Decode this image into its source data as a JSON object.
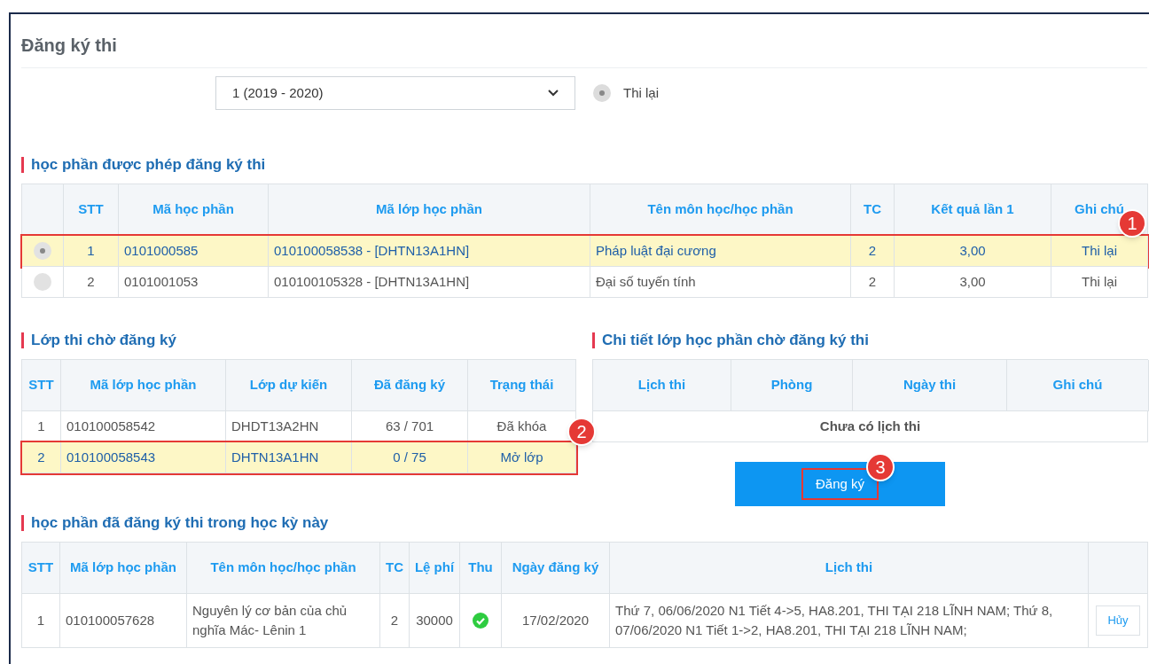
{
  "page_title": "Đăng ký thi",
  "term_select": {
    "value": "1 (2019 - 2020)"
  },
  "exam_types": [
    {
      "label": "Thi lại",
      "selected": true
    }
  ],
  "eligible_courses": {
    "title": "học phần được phép đăng ký thi",
    "columns": [
      "STT",
      "Mã học phần",
      "Mã lớp học phần",
      "Tên môn học/học phần",
      "TC",
      "Kết quả lần 1",
      "Ghi chú"
    ],
    "rows": [
      {
        "selected": true,
        "highlighted": true,
        "badge": "1",
        "cells": [
          "1",
          "0101000585",
          "010100058538 - [DHTN13A1HN]",
          "Pháp luật đại cương",
          "2",
          "3,00",
          "Thi lại"
        ]
      },
      {
        "selected": false,
        "highlighted": false,
        "cells": [
          "2",
          "0101001053",
          "010100105328 - [DHTN13A1HN]",
          "Đại số tuyến tính",
          "2",
          "3,00",
          "Thi lại"
        ]
      }
    ]
  },
  "pending_classes": {
    "title": "Lớp thi chờ đăng ký",
    "columns": [
      "STT",
      "Mã lớp học phần",
      "Lớp dự kiến",
      "Đã đăng ký",
      "Trạng thái"
    ],
    "rows": [
      {
        "highlighted": false,
        "cells": [
          "1",
          "010100058542",
          "DHDT13A2HN",
          "63 / 701",
          "Đã khóa"
        ]
      },
      {
        "highlighted": true,
        "badge": "2",
        "cells": [
          "2",
          "010100058543",
          "DHTN13A1HN",
          "0 / 75",
          "Mở lớp"
        ]
      }
    ]
  },
  "class_details": {
    "title": "Chi tiết lớp học phần chờ đăng ký thi",
    "columns": [
      "Lịch thi",
      "Phòng",
      "Ngày thi",
      "Ghi chú"
    ],
    "empty_message": "Chưa có lịch thi"
  },
  "register_button": {
    "label": "Đăng ký",
    "badge": "3"
  },
  "registered": {
    "title": "học phần đã đăng ký thi trong học kỳ này",
    "columns": [
      "STT",
      "Mã lớp học phần",
      "Tên môn học/học phần",
      "TC",
      "Lệ phí",
      "Thu",
      "Ngày đăng ký",
      "Lịch thi"
    ],
    "rows": [
      {
        "stt": "1",
        "class_code": "010100057628",
        "course": "Nguyên lý cơ bản của chủ nghĩa Mác- Lênin 1",
        "tc": "2",
        "fee": "30000",
        "paid": true,
        "date": "17/02/2020",
        "schedule": "Thứ 7, 06/06/2020 N1 Tiết 4->5, HA8.201, THI TẠI 218 LĨNH NAM; Thứ 8, 07/06/2020 N1 Tiết 1->2, HA8.201, THI TẠI 218 LĨNH NAM;",
        "cancel_label": "Hủy"
      }
    ]
  }
}
